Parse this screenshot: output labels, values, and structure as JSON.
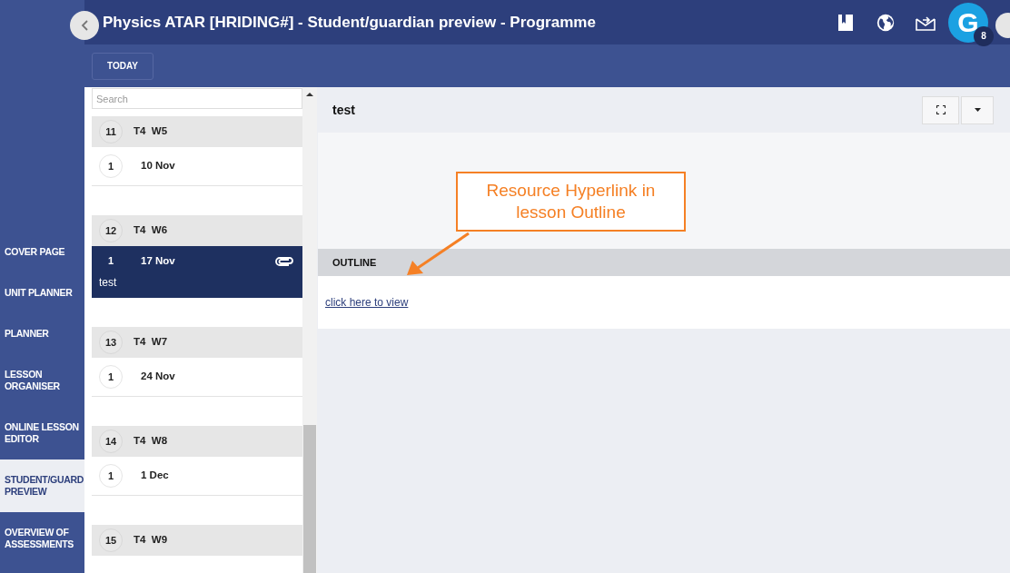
{
  "header": {
    "title": "Physics ATAR [HRIDING#] - Student/guardian preview - Programme",
    "avatar_letter": "G",
    "badge": "8"
  },
  "toolbar": {
    "today_button": "TODAY"
  },
  "sidebar": {
    "items": [
      {
        "label": "COVER PAGE",
        "selected": false
      },
      {
        "label": "UNIT PLANNER",
        "selected": false
      },
      {
        "label": "PLANNER",
        "selected": false
      },
      {
        "label": "LESSON ORGANISER",
        "selected": false
      },
      {
        "label": "ONLINE LESSON EDITOR",
        "selected": false
      },
      {
        "label": "STUDENT/GUARD PREVIEW",
        "selected": true
      },
      {
        "label": "OVERVIEW OF ASSESSMENTS",
        "selected": false
      }
    ]
  },
  "search": {
    "placeholder": "Search"
  },
  "weeks": [
    {
      "number": "11",
      "term": "T4",
      "week": "W5",
      "lessons": [
        {
          "number": "1",
          "date": "10 Nov",
          "selected": false
        }
      ]
    },
    {
      "number": "12",
      "term": "T4",
      "week": "W6",
      "lessons": [
        {
          "number": "1",
          "date": "17 Nov",
          "title": "test",
          "attachment": true,
          "selected": true
        }
      ]
    },
    {
      "number": "13",
      "term": "T4",
      "week": "W7",
      "lessons": [
        {
          "number": "1",
          "date": "24 Nov",
          "selected": false
        }
      ]
    },
    {
      "number": "14",
      "term": "T4",
      "week": "W8",
      "lessons": [
        {
          "number": "1",
          "date": "1 Dec",
          "selected": false
        }
      ]
    },
    {
      "number": "15",
      "term": "T4",
      "week": "W9"
    }
  ],
  "lesson": {
    "title": "test",
    "section": "OUTLINE",
    "link": "click here to view"
  },
  "annotation": {
    "text": "Resource Hyperlink in lesson Outline"
  }
}
